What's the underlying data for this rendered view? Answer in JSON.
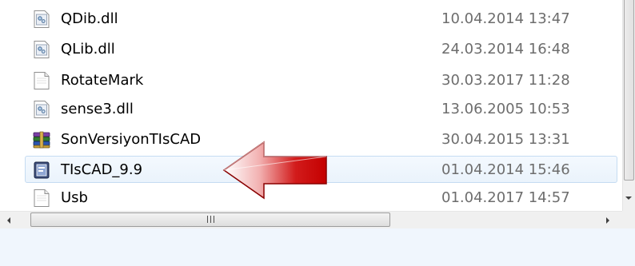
{
  "files": [
    {
      "name": "QDib.dll",
      "date": "10.04.2014 13:47",
      "icon": "dll-file-icon",
      "selected": false
    },
    {
      "name": "QLib.dll",
      "date": "24.03.2014 16:48",
      "icon": "dll-file-icon",
      "selected": false
    },
    {
      "name": "RotateMark",
      "date": "30.03.2017 11:28",
      "icon": "blank-file-icon",
      "selected": false
    },
    {
      "name": "sense3.dll",
      "date": "13.06.2005 10:53",
      "icon": "dll-file-icon",
      "selected": false
    },
    {
      "name": "SonVersiyonTIsCAD",
      "date": "30.04.2015 13:31",
      "icon": "winrar-archive-icon",
      "selected": false
    },
    {
      "name": "TIsCAD_9.9",
      "date": "01.04.2014 15:46",
      "icon": "application-icon",
      "selected": true
    },
    {
      "name": "Usb",
      "date": "01.04.2017 14:57",
      "icon": "blank-file-icon",
      "selected": false
    }
  ],
  "colors": {
    "selection_bg": "#eaf3fc",
    "selection_border": "#c5dcf2",
    "date_text": "#6d6d6d",
    "arrow_red": "#cc0000"
  },
  "overlay": {
    "icon": "red-arrow-pointer-icon",
    "points_to": "TIsCAD_9.9"
  }
}
